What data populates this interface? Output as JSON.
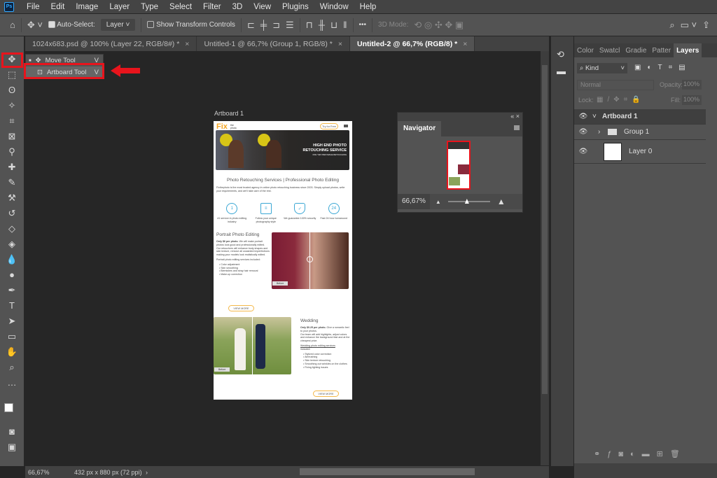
{
  "app": {
    "logo": "Ps",
    "menu": [
      "File",
      "Edit",
      "Image",
      "Layer",
      "Type",
      "Select",
      "Filter",
      "3D",
      "View",
      "Plugins",
      "Window",
      "Help"
    ]
  },
  "options": {
    "auto_select_label": "Auto-Select:",
    "auto_select_checked": true,
    "target": "Layer",
    "show_transform_label": "Show Transform Controls",
    "show_transform_checked": false,
    "more": "•••",
    "mode_label": "3D Mode:"
  },
  "tabs": [
    {
      "label": "1024x683.psd @ 100% (Layer 22, RGB/8#) *"
    },
    {
      "label": "Untitled-1 @ 66,7% (Group 1, RGB/8) *"
    },
    {
      "label": "Untitled-2 @ 66,7% (RGB/8) *",
      "active": true
    }
  ],
  "flyout": [
    {
      "label": "Move Tool",
      "key": "V"
    },
    {
      "label": "Artboard Tool",
      "key": "V",
      "highlighted": true
    }
  ],
  "highlight_color": "#e8141c",
  "artboard": {
    "label": "Artboard 1",
    "logo": "Fix",
    "logo_sub": "the photo",
    "try_btn": "Try for Free",
    "hero_title1": "HIGH END PHOTO",
    "hero_title2": "RETOUCHING SERVICE",
    "hero_sub": "ONLY $15 PER IMAGE RETOUCHING",
    "heading": "Photo Retouching Services | Professional Photo Editing",
    "intro": "Fixthephoto is the most trusted agency in online photo retouching business since 2003. Simply upload photos, write your requirements, and we'll take care of the rest.",
    "features": [
      {
        "icon": "1",
        "text": "#1 service in photo editing industry"
      },
      {
        "icon": "≡",
        "text": "Follow your unique photography style"
      },
      {
        "icon": "✓",
        "text": "We guarantee 100% security"
      },
      {
        "icon": "24",
        "text": "Fast 24 hour turnaround"
      }
    ],
    "portrait": {
      "title": "Portrait Photo Editing",
      "price": "Only $6 per photo.",
      "p1": "We will make portrait photos look good and professionally edited.",
      "p2": "Our retouchers will enhance body shapes and skin texture, remove all unwanted imperfections making your models look realistically edited.",
      "list_label": "Portrait photo editing services included:",
      "items": [
        "Color adjustment",
        "Skin smoothing",
        "Blemishes and stray hair removal",
        "Make-up correction"
      ],
      "button": "VIEW MORE",
      "before": "Before"
    },
    "wedding": {
      "title": "Wedding",
      "price": "Only $0.25 per photo.",
      "p1": "Give a romantic feel to your photos.",
      "p2": "Our team will add highlights, adjust colors and enhance the background fast and at the cheapest price.",
      "list_label": "Wedding photo editing services",
      "list_label2": "included:",
      "items": [
        "Stylized color correction",
        "Airbrushing",
        "Skin texture retouching",
        "Smoothing out wrinkles on the clothes",
        "Fixing lighting issues"
      ],
      "button": "VIEW MORE",
      "before": "Before"
    }
  },
  "navigator": {
    "title": "Navigator",
    "zoom": "66,67%"
  },
  "panels": {
    "tabs": [
      "Color",
      "Swatcl",
      "Gradie",
      "Patter",
      "Layers"
    ],
    "filter": "Kind",
    "blend": "Normal",
    "opacity_label": "Opacity:",
    "opacity": "100%",
    "lock_label": "Lock:",
    "fill_label": "Fill:",
    "fill": "100%"
  },
  "layers": [
    {
      "name": "Artboard 1",
      "type": "artboard",
      "expanded": true
    },
    {
      "name": "Group 1",
      "type": "group"
    },
    {
      "name": "Layer 0",
      "type": "layer"
    }
  ],
  "status": {
    "zoom": "66,67%",
    "doc": "432 px x 880 px (72 ppi)"
  }
}
